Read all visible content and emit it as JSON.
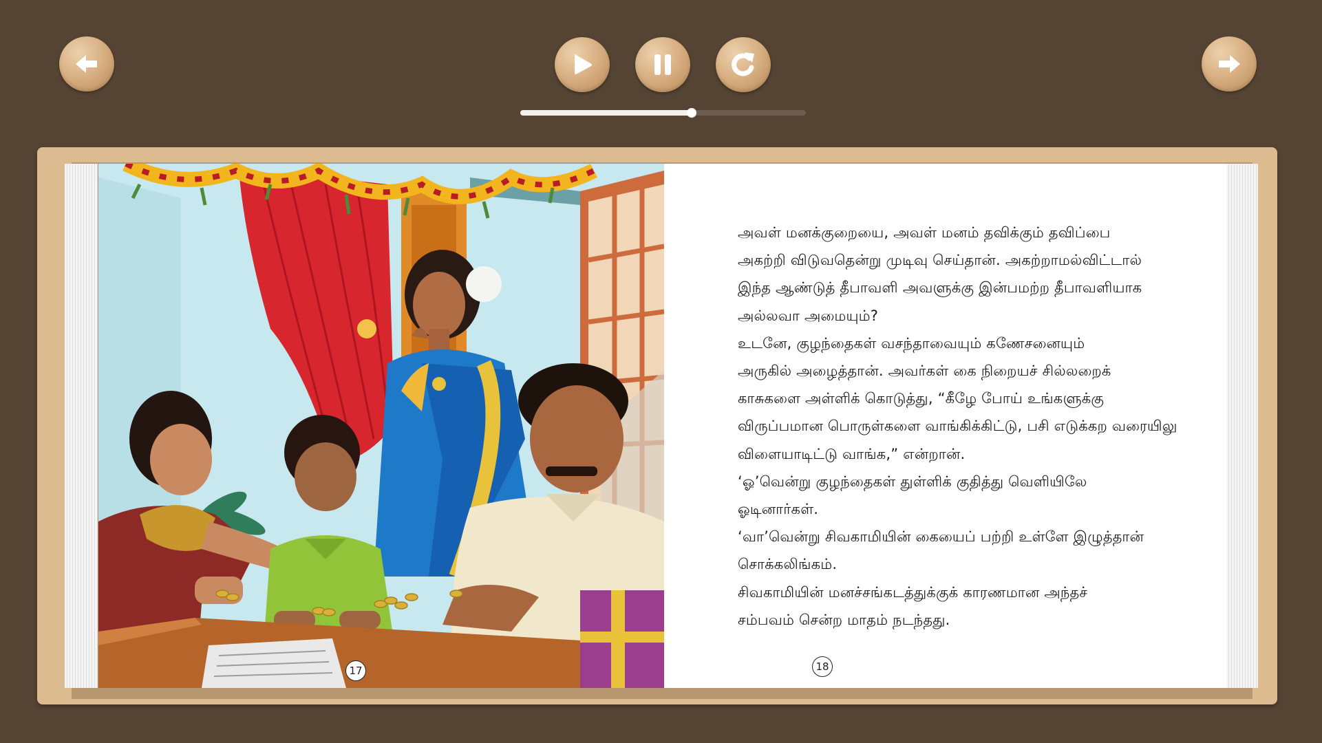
{
  "toolbar": {
    "prev_icon": "arrow-left-icon",
    "play_icon": "play-icon",
    "pause_icon": "pause-icon",
    "replay_icon": "replay-icon",
    "next_icon": "arrow-right-icon",
    "button_color": "#d9b184",
    "background_color": "#554434"
  },
  "audio_progress": {
    "fraction": 0.6
  },
  "book": {
    "left_page": {
      "page_number": "17",
      "illustration": "family-diwali-illustration"
    },
    "right_page": {
      "page_number": "18",
      "lines": [
        "அவள் மனக்குறையை, அவள் மனம் தவிக்கும் தவிப்பை",
        "அகற்றி விடுவதென்று முடிவு செய்தான். அகற்றாமல்விட்டால்",
        "இந்த ஆண்டுத் தீபாவளி அவளுக்கு இன்பமற்ற தீபாவளியாக",
        "அல்லவா அமையும்?",
        "உடனே, குழந்தைகள் வசந்தாவையும் கணேசனையும்",
        "அருகில் அழைத்தான். அவர்கள் கை நிறையச் சில்லறைக்",
        "காசுகளை அள்ளிக் கொடுத்து, “கீழே போய் உங்களுக்கு",
        "விருப்பமான பொருள்களை வாங்கிக்கிட்டு, பசி எடுக்கற வரையிலு",
        "விளையாடிட்டு வாங்க,” என்றான்.",
        "‘ஓ’வென்று குழந்தைகள் துள்ளிக் குதித்து வெளியிலே",
        "ஓடினார்கள்.",
        "‘வா’வென்று சிவகாமியின் கையைப் பற்றி உள்ளே இழுத்தான்",
        "சொக்கலிங்கம்.",
        "சிவகாமியின் மனச்சங்கடத்துக்குக் காரணமான அந்தச்",
        "சம்பவம் சென்ற மாதம் நடந்தது."
      ]
    }
  }
}
